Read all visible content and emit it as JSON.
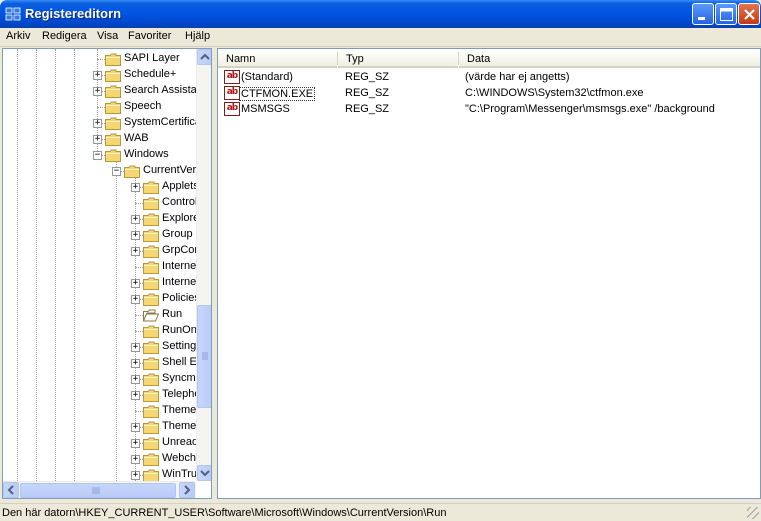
{
  "window": {
    "title": "Registereditorn"
  },
  "menu": [
    "Arkiv",
    "Redigera",
    "Visa",
    "Favoriter",
    "Hjälp"
  ],
  "tree": {
    "items": [
      {
        "label": "SAPI Layer",
        "expander": ""
      },
      {
        "label": "Schedule+",
        "expander": "+"
      },
      {
        "label": "Search Assistant",
        "expander": "+"
      },
      {
        "label": "Speech",
        "expander": ""
      },
      {
        "label": "SystemCertificates",
        "expander": "+"
      },
      {
        "label": "WAB",
        "expander": "+"
      },
      {
        "label": "Windows",
        "expander": "−"
      },
      {
        "label": "CurrentVersion",
        "expander": "−"
      },
      {
        "label": "Applets",
        "expander": "+"
      },
      {
        "label": "Controls Folder",
        "expander": ""
      },
      {
        "label": "Explorer",
        "expander": "+"
      },
      {
        "label": "Group Policy",
        "expander": "+"
      },
      {
        "label": "GrpConv",
        "expander": "+"
      },
      {
        "label": "Internet",
        "expander": ""
      },
      {
        "label": "Internet Settings",
        "expander": "+"
      },
      {
        "label": "Policies",
        "expander": "+"
      },
      {
        "label": "Run",
        "expander": "",
        "open": true
      },
      {
        "label": "RunOnce",
        "expander": ""
      },
      {
        "label": "Settings",
        "expander": "+"
      },
      {
        "label": "Shell Extensions",
        "expander": "+"
      },
      {
        "label": "Syncmgr",
        "expander": "+"
      },
      {
        "label": "Telephony",
        "expander": "+"
      },
      {
        "label": "ThemeManager",
        "expander": ""
      },
      {
        "label": "Themes",
        "expander": "+"
      },
      {
        "label": "UnreadMail",
        "expander": "+"
      },
      {
        "label": "Webcheck",
        "expander": "+"
      },
      {
        "label": "WinTrust",
        "expander": "+"
      }
    ]
  },
  "list": {
    "columns": [
      "Namn",
      "Typ",
      "Data"
    ],
    "rows": [
      {
        "name": "(Standard)",
        "type": "REG_SZ",
        "data": "(värde har ej angetts)"
      },
      {
        "name": "CTFMON.EXE",
        "type": "REG_SZ",
        "data": "C:\\WINDOWS\\System32\\ctfmon.exe"
      },
      {
        "name": "MSMSGS",
        "type": "REG_SZ",
        "data": "\"C:\\Program\\Messenger\\msmsgs.exe\" /background"
      }
    ],
    "value_icon": "ab"
  },
  "status": {
    "path": "Den här datorn\\HKEY_CURRENT_USER\\Software\\Microsoft\\Windows\\CurrentVersion\\Run"
  },
  "colors": {
    "titlebar": "#0054e3",
    "folder": "#f5d773",
    "list_border": "#7f9db9"
  },
  "icons": {
    "app": "registry-editor-icon",
    "folder": "folder-icon",
    "value": "string-value-icon"
  }
}
